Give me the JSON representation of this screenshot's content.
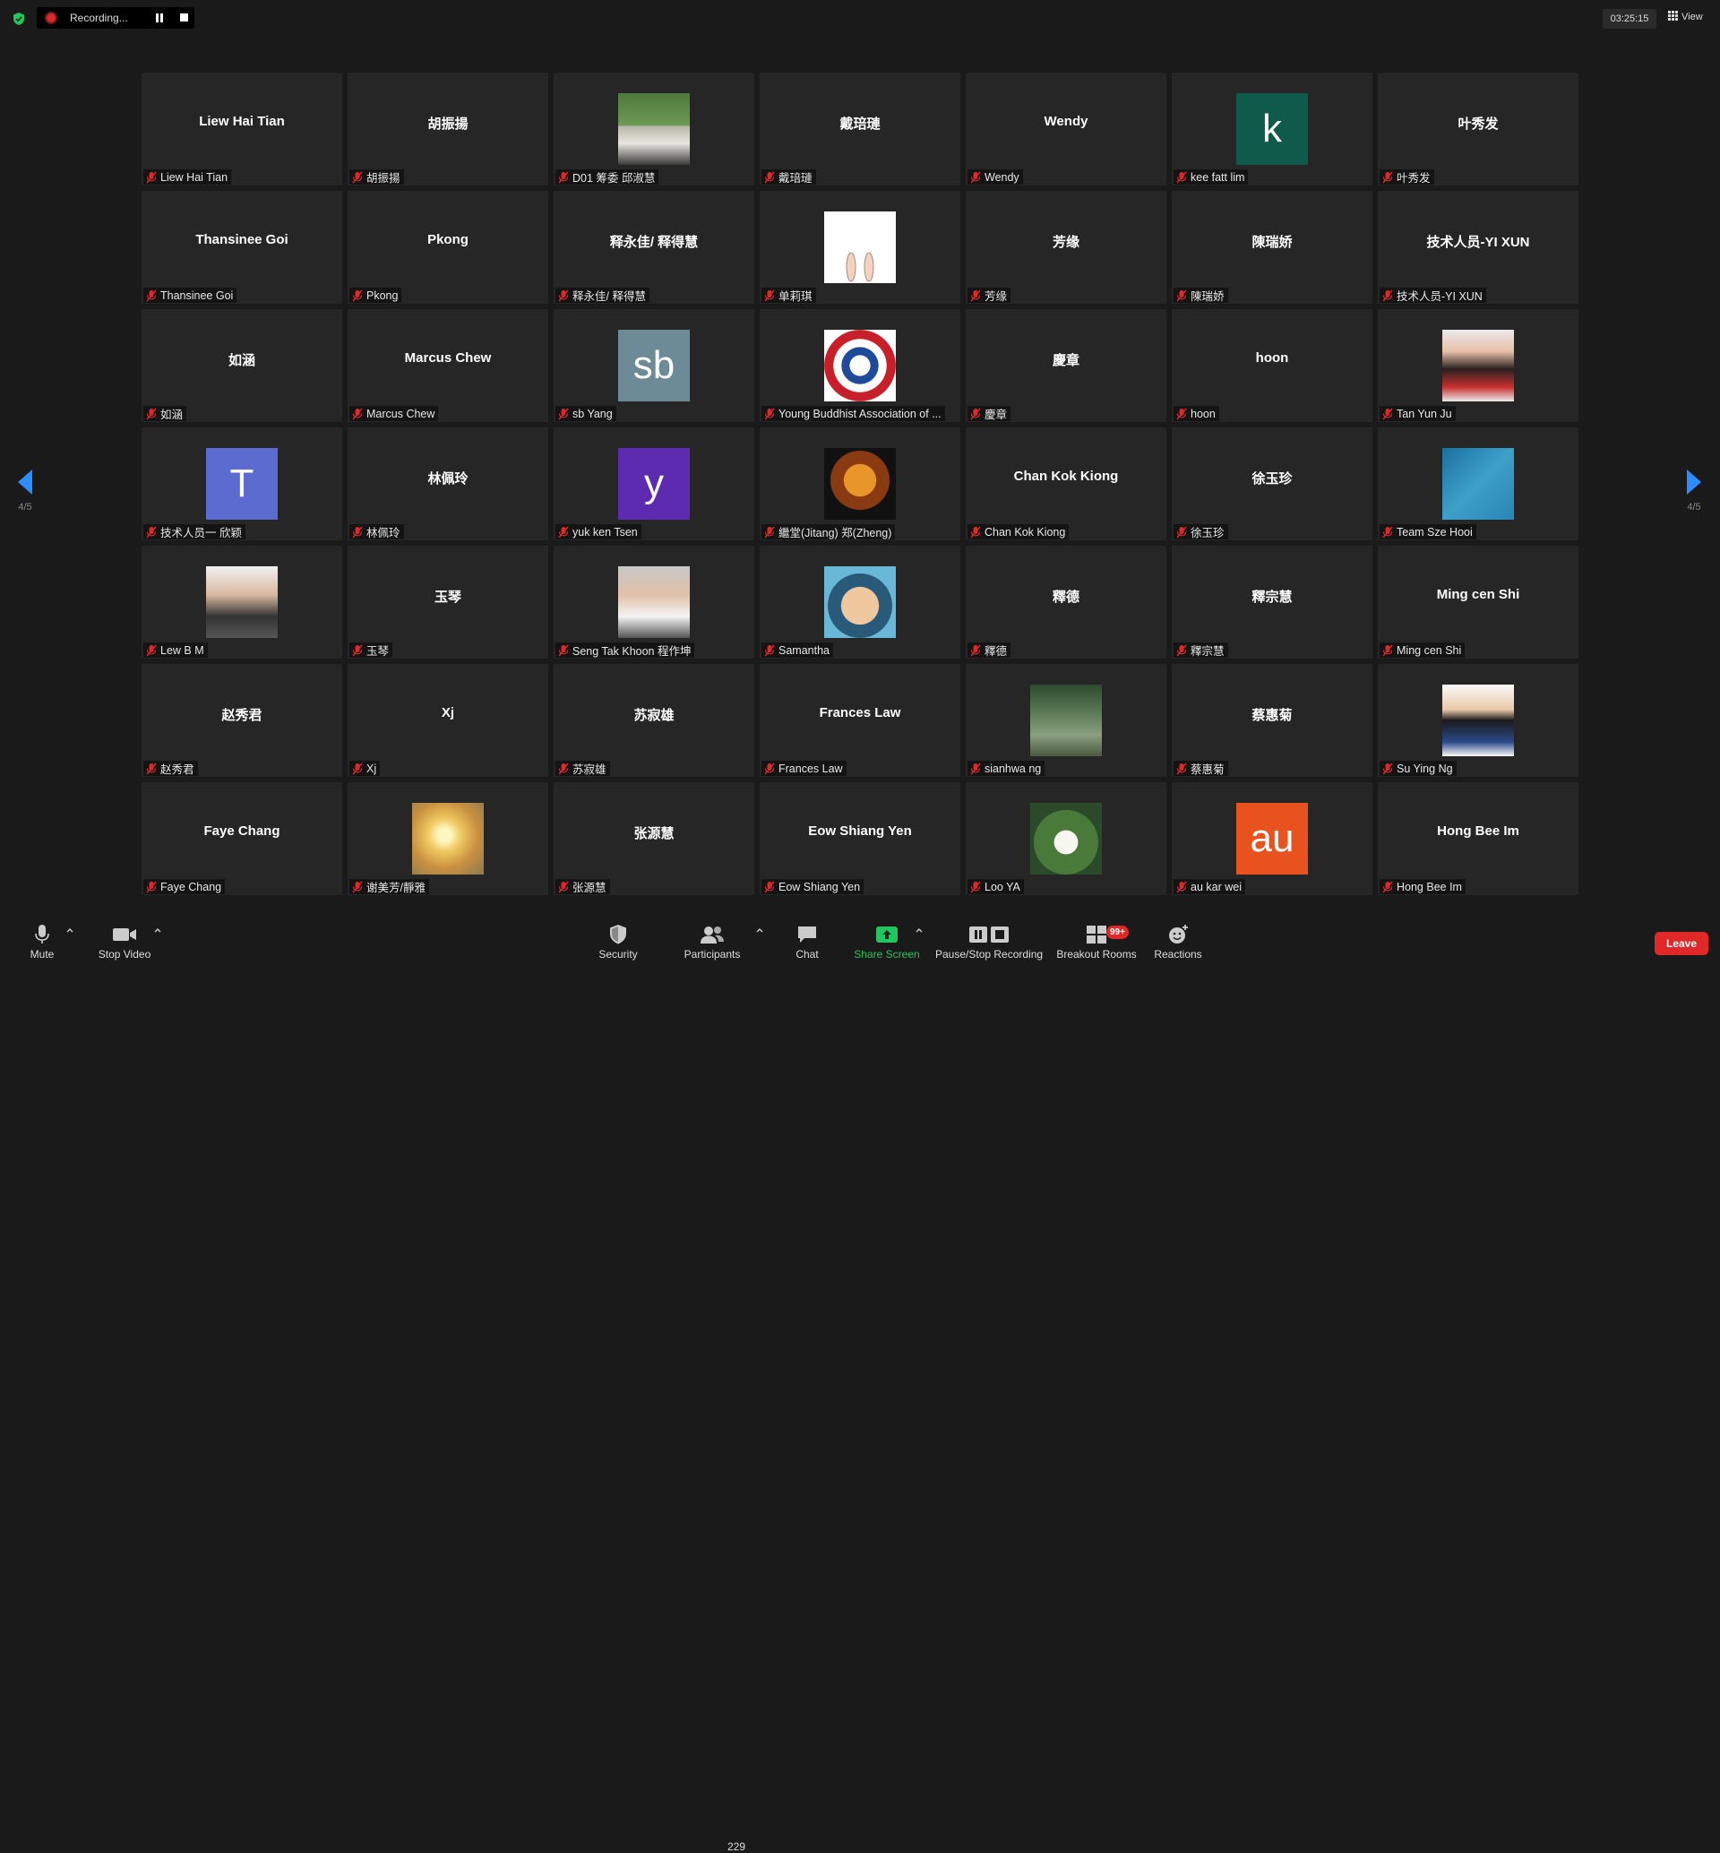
{
  "recording": {
    "label": "Recording...",
    "dot_color": "#e02828"
  },
  "header": {
    "timer": "03:25:15",
    "view_label": "View"
  },
  "pager": {
    "left": "4/5",
    "right": "4/5",
    "accent": "#2d8cff"
  },
  "participants": [
    {
      "name": "Liew Hai Tian",
      "big": "Liew Hai Tian"
    },
    {
      "name": "胡振揚",
      "big": "胡振揚"
    },
    {
      "name": "D01 筹委 邱淑慧",
      "photo": "person-photo"
    },
    {
      "name": "戴琣璉",
      "big": "戴琣璉"
    },
    {
      "name": "Wendy",
      "big": "Wendy"
    },
    {
      "name": "kee fatt lim",
      "letter": "k",
      "color": "#0f5a4a"
    },
    {
      "name": "叶秀发",
      "big": "叶秀发"
    },
    {
      "name": "Thansinee Goi",
      "big": "Thansinee Goi"
    },
    {
      "name": "Pkong",
      "big": "Pkong"
    },
    {
      "name": "释永佳/ 释得慧",
      "big": "释永佳/ 释得慧"
    },
    {
      "name": "单莉琪",
      "photo": "rabbit-illustration"
    },
    {
      "name": "芳缘",
      "big": "芳缘"
    },
    {
      "name": "陳瑞娇",
      "big": "陳瑞娇"
    },
    {
      "name": "技术人员-YI XUN",
      "big": "技术人员-YI XUN"
    },
    {
      "name": "如涵",
      "big": "如涵"
    },
    {
      "name": "Marcus Chew",
      "big": "Marcus Chew"
    },
    {
      "name": "sb Yang",
      "letter": "sb",
      "color": "#6d8a97"
    },
    {
      "name": "Young Buddhist Association of ...",
      "photo": "association-logo"
    },
    {
      "name": "慶章",
      "big": "慶章"
    },
    {
      "name": "hoon",
      "big": "hoon"
    },
    {
      "name": "Tan Yun Ju",
      "photo": "woman-portrait"
    },
    {
      "name": "技术人员一 欣颖",
      "letter": "T",
      "color": "#5b6bd0"
    },
    {
      "name": "林佩玲",
      "big": "林佩玲"
    },
    {
      "name": "yuk ken Tsen",
      "letter": "y",
      "color": "#5c2bb0"
    },
    {
      "name": "繼堂(Jitang) 郑(Zheng)",
      "photo": "lion-cartoon"
    },
    {
      "name": "Chan Kok Kiong",
      "big": "Chan Kok Kiong"
    },
    {
      "name": "徐玉珍",
      "big": "徐玉珍"
    },
    {
      "name": "Team Sze Hooi",
      "photo": "blue-artwork"
    },
    {
      "name": "Lew B M",
      "photo": "man-portrait"
    },
    {
      "name": "玉琴",
      "big": "玉琴"
    },
    {
      "name": "Seng Tak Khoon 程作坤",
      "photo": "man-portrait-glasses"
    },
    {
      "name": "Samantha",
      "photo": "cartoon-girl"
    },
    {
      "name": "釋德",
      "big": "釋德"
    },
    {
      "name": "釋宗慧",
      "big": "釋宗慧"
    },
    {
      "name": "Ming cen Shi",
      "big": "Ming cen Shi"
    },
    {
      "name": "赵秀君",
      "big": "赵秀君"
    },
    {
      "name": "Xj",
      "big": "Xj"
    },
    {
      "name": "苏寂雄",
      "big": "苏寂雄"
    },
    {
      "name": "Frances Law",
      "big": "Frances Law"
    },
    {
      "name": "sianhwa ng",
      "photo": "person-outdoors"
    },
    {
      "name": "蔡惠菊",
      "big": "蔡惠菊"
    },
    {
      "name": "Su Ying Ng",
      "photo": "girl-portrait"
    },
    {
      "name": "Faye Chang",
      "big": "Faye Chang"
    },
    {
      "name": "谢美芳/靜雅",
      "photo": "sunset-photo"
    },
    {
      "name": "张源慧",
      "big": "张源慧"
    },
    {
      "name": "Eow Shiang Yen",
      "big": "Eow Shiang Yen"
    },
    {
      "name": "Loo YA",
      "photo": "lotus-flower"
    },
    {
      "name": "au kar wei",
      "letter": "au",
      "color": "#e8521f"
    },
    {
      "name": "Hong Bee Im",
      "big": "Hong Bee Im"
    }
  ],
  "toolbar": {
    "mute": "Mute",
    "stop_video": "Stop Video",
    "security": "Security",
    "participants": "Participants",
    "participant_count": "229",
    "chat": "Chat",
    "share_screen": "Share Screen",
    "pause_stop_recording": "Pause/Stop Recording",
    "breakout_rooms": "Breakout Rooms",
    "breakout_badge": "99+",
    "reactions": "Reactions",
    "leave": "Leave",
    "share_color": "#22c55e",
    "leave_color": "#e02828"
  }
}
